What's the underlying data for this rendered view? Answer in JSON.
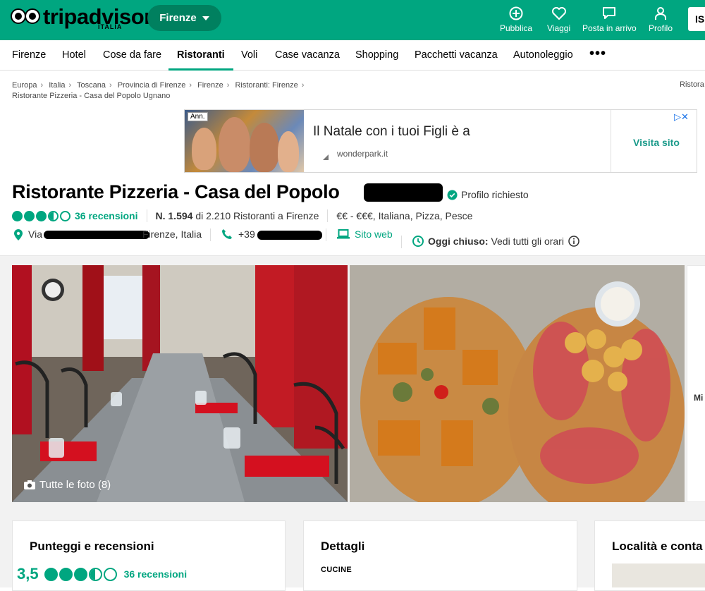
{
  "brand": {
    "name": "tripadvisor",
    "region": "ITALIA"
  },
  "geo": {
    "label": "Firenze"
  },
  "top_actions": [
    {
      "label": "Pubblica",
      "icon": "plus-circle-icon"
    },
    {
      "label": "Viaggi",
      "icon": "heart-icon"
    },
    {
      "label": "Posta in arrivo",
      "icon": "message-icon"
    },
    {
      "label": "Profilo",
      "icon": "user-icon"
    }
  ],
  "signin_label": "IS",
  "subnav": [
    "Firenze",
    "Hotel",
    "Cose da fare",
    "Ristoranti",
    "Voli",
    "Case vacanza",
    "Shopping",
    "Pacchetti vacanza",
    "Autonoleggio"
  ],
  "subnav_active": "Ristoranti",
  "breadcrumbs": [
    "Europa",
    "Italia",
    "Toscana",
    "Provincia di Firenze",
    "Firenze",
    "Ristoranti: Firenze"
  ],
  "breadcrumb_current": "Ristorante Pizzeria - Casa del Popolo Ugnano",
  "breadcrumb_right": "Ristora",
  "ad": {
    "badge": "Ann.",
    "headline": "Il Natale con i tuoi Figli è a",
    "domain": "wonderpark.it",
    "cta": "Visita sito"
  },
  "restaurant": {
    "name": "Ristorante Pizzeria - Casa del Popolo",
    "claimed": "Profilo richiesto",
    "rating": 3.5,
    "reviews": "36 recensioni",
    "rank_bold": "N. 1.594",
    "rank_rest": "di 2.210 Ristoranti a Firenze",
    "cuisine": "€€ - €€€, Italiana, Pizza, Pesce",
    "address_prefix": "Via",
    "address_suffix": "Firenze, Italia",
    "phone_prefix": "+39",
    "website": "Sito web",
    "status_bold": "Oggi chiuso:",
    "status_rest": "Vedi tutti gli orari"
  },
  "photos": {
    "all_label": "Tutte le foto (8)",
    "side_label": "Mi"
  },
  "cards": {
    "ratings_title": "Punteggi e recensioni",
    "ratings_score": "3,5",
    "ratings_reviews": "36 recensioni",
    "details_title": "Dettagli",
    "details_sub": "CUCINE",
    "location_title": "Località e conta"
  },
  "colors": {
    "brand": "#00a680",
    "brand_dark": "#00805f"
  }
}
